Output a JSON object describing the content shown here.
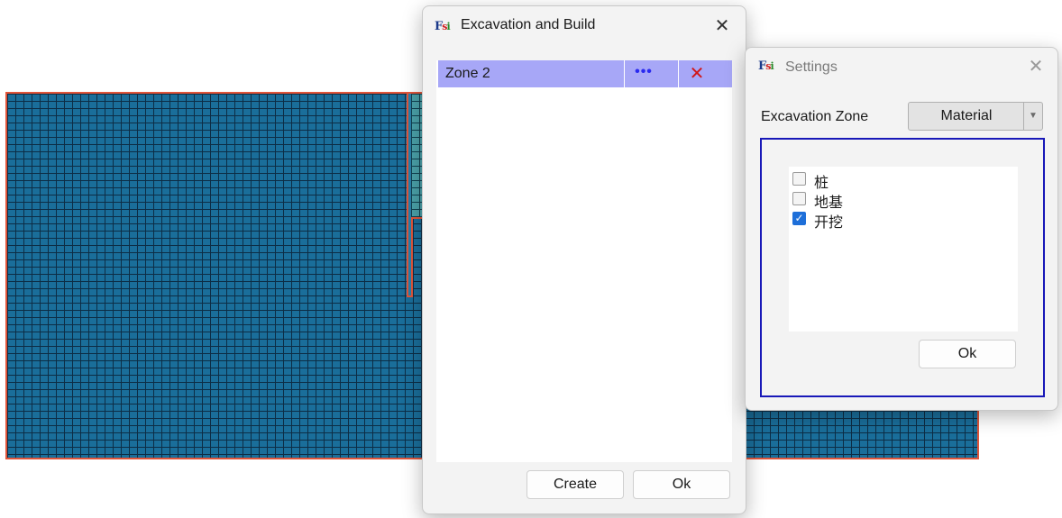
{
  "excavation_dialog": {
    "title": "Excavation and Build",
    "close_glyph": "✕",
    "zones": [
      {
        "name": "Zone 2",
        "more_glyph": "•••",
        "delete_glyph": "✕"
      }
    ],
    "create_label": "Create",
    "ok_label": "Ok"
  },
  "settings_dialog": {
    "title": "Settings",
    "close_glyph": "✕",
    "excavation_zone_label": "Excavation Zone",
    "select_value": "Material",
    "select_arrow": "▼",
    "materials": [
      {
        "label": "桩",
        "checked": false
      },
      {
        "label": "地基",
        "checked": false
      },
      {
        "label": "开挖",
        "checked": true
      }
    ],
    "check_glyph": "✓",
    "ok_label": "Ok"
  },
  "logo": {
    "f": "F",
    "s": "s",
    "i": "i"
  },
  "colors": {
    "mesh_fill": "#1a6e9a",
    "mesh_border": "#e0553a",
    "zone_selected": "#a7a7f7",
    "frame_blue": "#1818b8",
    "checkbox_checked": "#1e6fd9"
  }
}
